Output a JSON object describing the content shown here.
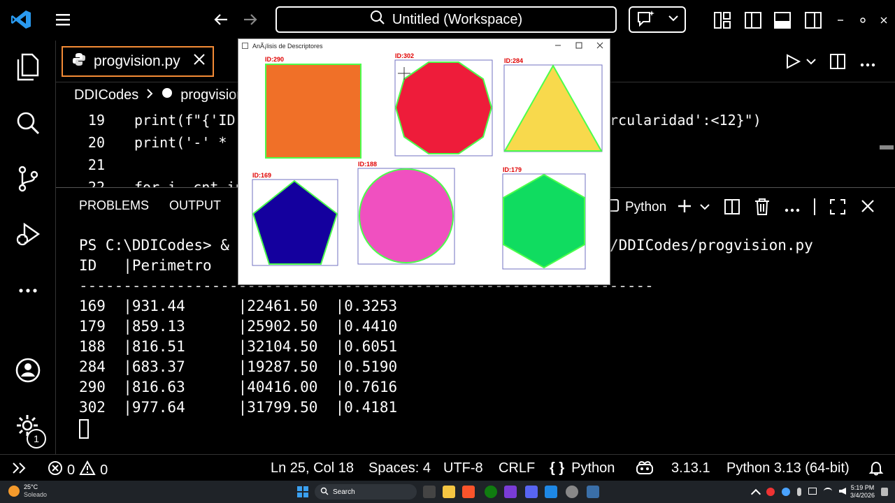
{
  "titlebar": {
    "search_text": "Untitled (Workspace)"
  },
  "editor": {
    "tab_label": "progvision.py",
    "breadcrumb": [
      "DDICodes",
      "progvision.py"
    ],
    "lines": [
      {
        "num": "19",
        "text": "print(f\"{'ID"
      },
      {
        "num": "20",
        "text": "print('-' *"
      },
      {
        "num": "21",
        "text": ""
      },
      {
        "num": "22",
        "text": "for i, cnt in"
      }
    ],
    "line19_tail": "rcularidad':<12}\")"
  },
  "panel": {
    "tabs": [
      "PROBLEMS",
      "OUTPUT"
    ],
    "terminal_label": "Python",
    "prompt_start": "PS C:\\DDICodes> &",
    "prompt_end": "/DDICodes/progvision.py",
    "header": "ID   |Perimetro",
    "separator": "-----------------------------------------------------------------",
    "rows": [
      "169  |931.44      |22461.50  |0.3253",
      "179  |859.13      |25902.50  |0.4410",
      "188  |816.51      |32104.50  |0.6051",
      "284  |683.37      |19287.50  |0.5190",
      "290  |816.63      |40416.00  |0.7616",
      "302  |977.64      |31799.50  |0.4181"
    ]
  },
  "cv_window": {
    "title": "AnÃ¡lisis de Descriptores",
    "labels": {
      "orange": "ID:290",
      "red": "ID:302",
      "yellow": "ID:284",
      "blue": "ID:169",
      "pink": "ID:188",
      "green": "ID:179"
    }
  },
  "statusbar": {
    "errors": "0",
    "warnings": "0",
    "position": "Ln 25, Col 18",
    "spaces": "Spaces: 4",
    "encoding": "UTF-8",
    "eol": "CRLF",
    "language": "Python",
    "version": "3.13.1",
    "interpreter": "Python 3.13 (64-bit)"
  },
  "taskbar": {
    "weather_temp": "25°C",
    "weather_desc": "Soleado",
    "search_label": "Search",
    "time": "5:19 PM",
    "date": "3/4/2026"
  },
  "settings_badge": "1",
  "colors": {
    "accent_tab_border": "#f48b36",
    "orange": "#f07028",
    "red": "#ee1c3a",
    "yellow": "#f8d94c",
    "blue": "#14009e",
    "pink": "#f050c0",
    "green": "#10dc60",
    "contour": "#4cff4c"
  }
}
